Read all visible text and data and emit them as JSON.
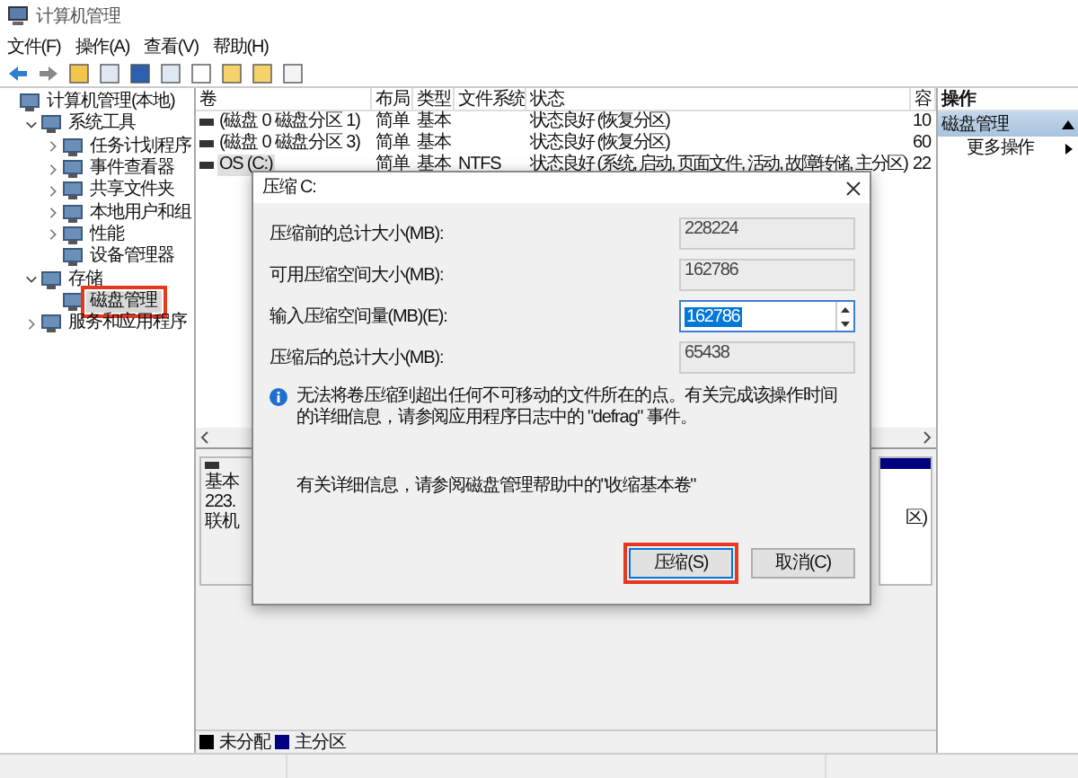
{
  "window": {
    "title": "计算机管理"
  },
  "menu": [
    "文件(F)",
    "操作(A)",
    "查看(V)",
    "帮助(H)"
  ],
  "tree": [
    {
      "label": "计算机管理(本地)",
      "expandable": false,
      "expanded": true,
      "selected": false,
      "highlighted": false,
      "children": [
        {
          "label": "系统工具",
          "expandable": true,
          "expanded": true,
          "selected": false,
          "highlighted": false,
          "children": [
            {
              "label": "任务计划程序",
              "expandable": true,
              "expanded": false,
              "selected": false,
              "highlighted": false
            },
            {
              "label": "事件查看器",
              "expandable": true,
              "expanded": false,
              "selected": false,
              "highlighted": false
            },
            {
              "label": "共享文件夹",
              "expandable": true,
              "expanded": false,
              "selected": false,
              "highlighted": false
            },
            {
              "label": "本地用户和组",
              "expandable": true,
              "expanded": false,
              "selected": false,
              "highlighted": false
            },
            {
              "label": "性能",
              "expandable": true,
              "expanded": false,
              "selected": false,
              "highlighted": false
            },
            {
              "label": "设备管理器",
              "expandable": false,
              "expanded": false,
              "selected": false,
              "highlighted": false
            }
          ]
        },
        {
          "label": "存储",
          "expandable": true,
          "expanded": true,
          "selected": false,
          "highlighted": false,
          "children": [
            {
              "label": "磁盘管理",
              "expandable": false,
              "expanded": false,
              "selected": true,
              "highlighted": true
            }
          ]
        },
        {
          "label": "服务和应用程序",
          "expandable": true,
          "expanded": false,
          "selected": false,
          "highlighted": false
        }
      ]
    }
  ],
  "table": {
    "columns": [
      "卷",
      "布局",
      "类型",
      "文件系统",
      "状态",
      "容"
    ],
    "rows": [
      {
        "volume": "(磁盘 0 磁盘分区 1)",
        "layout": "简单",
        "type": "基本",
        "status": "状态良好 (恢复分区)",
        "capacity": "10",
        "selected": false
      },
      {
        "volume": "(磁盘 0 磁盘分区 3)",
        "layout": "简单",
        "type": "基本",
        "status": "状态良好 (恢复分区)",
        "capacity": "60",
        "selected": false
      },
      {
        "volume": "OS (C:)",
        "layout": "简单",
        "type": "基本",
        "filesystem": "NTFS",
        "status": "状态良好 (系统, 启动, 页面文件, 活动, 故障转储, 主分区)",
        "capacity": "22",
        "selected": true
      }
    ]
  },
  "disk_panel": {
    "left_lines": [
      "基本",
      "223.",
      "联机"
    ],
    "right_text": "区)"
  },
  "legend": [
    {
      "label": "未分配",
      "color": "#000000"
    },
    {
      "label": "主分区",
      "color": "#000080"
    }
  ],
  "actions": {
    "title": "操作",
    "section": {
      "label": "磁盘管理",
      "expanded": true
    },
    "items": [
      "更多操作"
    ]
  },
  "dialog": {
    "title": "压缩 C:",
    "fields": [
      {
        "label": "压缩前的总计大小(MB):",
        "value": "228224",
        "kind": "readonly"
      },
      {
        "label": "可用压缩空间大小(MB):",
        "value": "162786",
        "kind": "readonly"
      },
      {
        "label": "输入压缩空间量(MB)(E):",
        "value": "162786",
        "kind": "spin"
      },
      {
        "label": "压缩后的总计大小(MB):",
        "value": "65438",
        "kind": "readonly"
      }
    ],
    "info": "无法将卷压缩到超出任何不可移动的文件所在的点。有关完成该操作时间的详细信息，请参阅应用程序日志中的 \"defrag\" 事件。",
    "help": "有关详细信息，请参阅磁盘管理帮助中的\"收缩基本卷\"",
    "buttons": [
      {
        "label": "压缩(S)",
        "default": true,
        "highlighted": true
      },
      {
        "label": "取消(C)",
        "default": false,
        "highlighted": false
      }
    ]
  }
}
